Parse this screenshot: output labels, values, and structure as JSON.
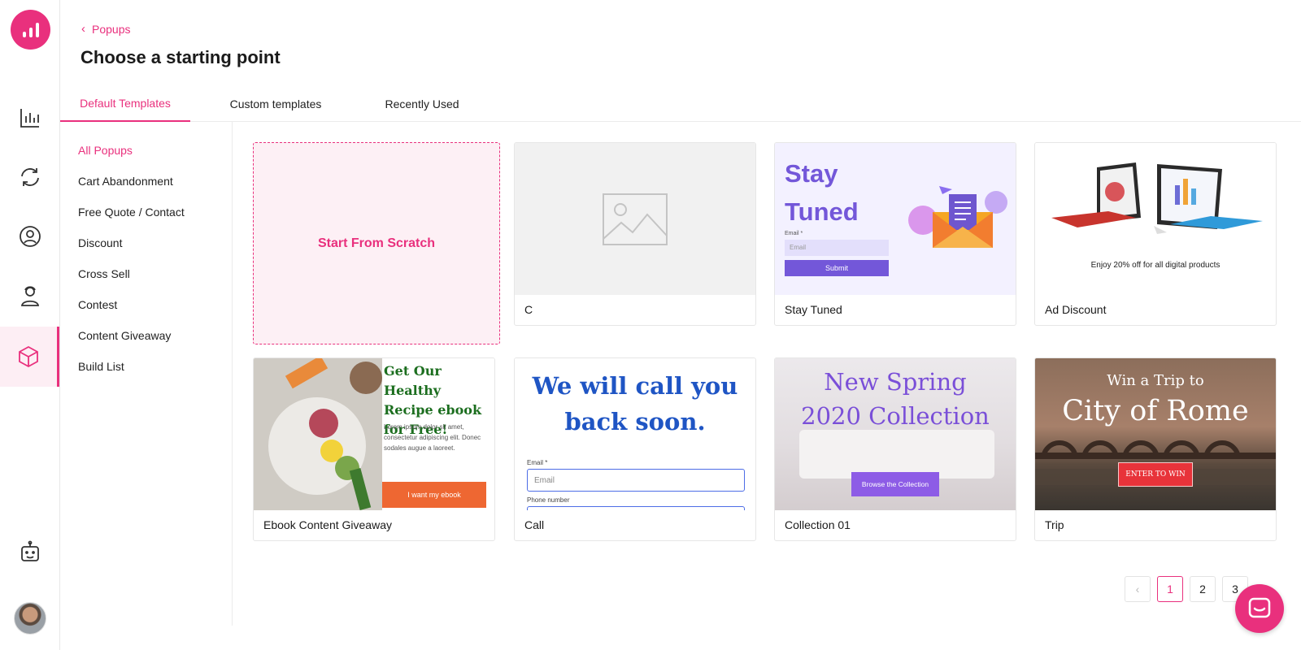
{
  "header": {
    "back_label": "Popups",
    "title": "Choose a starting point"
  },
  "tabs": [
    {
      "label": "Default Templates",
      "active": true
    },
    {
      "label": "Custom templates",
      "active": false
    },
    {
      "label": "Recently Used",
      "active": false
    }
  ],
  "categories": [
    {
      "label": "All Popups",
      "active": true
    },
    {
      "label": "Cart Abandonment"
    },
    {
      "label": "Free Quote / Contact"
    },
    {
      "label": "Discount"
    },
    {
      "label": "Cross Sell"
    },
    {
      "label": "Contest"
    },
    {
      "label": "Content Giveaway"
    },
    {
      "label": "Build List"
    }
  ],
  "scratch_label": "Start From Scratch",
  "templates": [
    {
      "name": "C"
    },
    {
      "name": "Stay Tuned",
      "preview": {
        "heading_1": "Stay",
        "heading_2": "Tuned",
        "email_label": "Email *",
        "email_placeholder": "Email",
        "button": "Submit"
      }
    },
    {
      "name": "Ad Discount",
      "preview": {
        "text": "Enjoy 20% off for all digital products"
      }
    },
    {
      "name": "Ebook Content Giveaway",
      "preview": {
        "heading": "Get Our Healthy Recipe ebook for Free!",
        "body": "Lorem ipsum dolor sit amet, consectetur adipiscing elit. Donec sodales augue a laoreet.",
        "button": "I want my ebook"
      }
    },
    {
      "name": "Call",
      "preview": {
        "heading": "We will call you back soon.",
        "email_label": "Email *",
        "email_placeholder": "Email",
        "phone_label": "Phone number"
      }
    },
    {
      "name": "Collection 01",
      "preview": {
        "heading_1": "New Spring",
        "heading_2": "2020 Collection",
        "button": "Browse the Collection"
      }
    },
    {
      "name": "Trip",
      "preview": {
        "heading_1": "Win a Trip to",
        "heading_2": "City of Rome",
        "button": "ENTER TO WIN"
      }
    }
  ],
  "pagination": {
    "prev": "‹",
    "pages": [
      "1",
      "2",
      "3"
    ],
    "current": "1"
  },
  "colors": {
    "accent": "#e9307d",
    "purple": "#7357d9",
    "blue": "#1f55c4",
    "orange": "#ee6732",
    "green": "#1c6e1f"
  },
  "icons": [
    "analytics-icon",
    "sync-icon",
    "audience-icon",
    "user-icon",
    "cube-icon",
    "bot-icon",
    "chat-icon",
    "image-placeholder-icon"
  ]
}
